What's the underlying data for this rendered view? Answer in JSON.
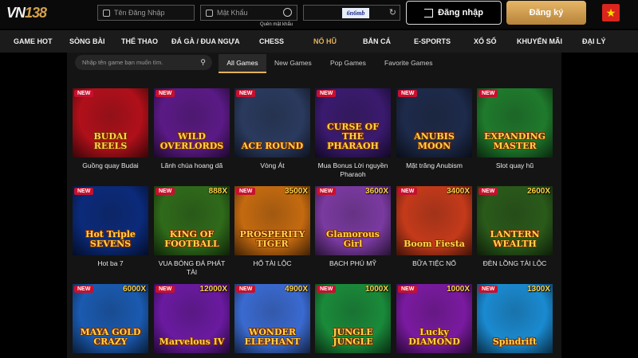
{
  "header": {
    "logo_main": "VN",
    "logo_num": "138",
    "username_placeholder": "Tên Đăng Nhập",
    "password_placeholder": "Mật Khẩu",
    "forgot_password": "Quên mật khẩu",
    "captcha_text": "6n6mb",
    "refresh_icon": "↻",
    "login_label": "Đăng nhập",
    "register_label": "Đăng ký",
    "flag_star": "★"
  },
  "nav": {
    "items": [
      "GAME HOT",
      "SÒNG BÀI",
      "THỂ THAO",
      "ĐÁ GÀ / ĐUA NGỰA",
      "CHESS",
      "NỔ HŨ",
      "BẮN CÁ",
      "E-SPORTS",
      "XỔ SỐ",
      "KHUYẾN MÃI",
      "ĐẠI LÝ"
    ],
    "active": "NỔ HŨ"
  },
  "search": {
    "placeholder": "Nhập tên game bạn muốn tìm."
  },
  "tabs": [
    "All Games",
    "New Games",
    "Pop Games",
    "Favorite Games"
  ],
  "badge_text": "NEW",
  "games": [
    {
      "caption": "Guồng quay Budai",
      "title": "BUDAI REELS",
      "multiplier": "",
      "bg": "#b0101a"
    },
    {
      "caption": "Lãnh chúa hoang dã",
      "title": "WILD OVERLORDS",
      "multiplier": "",
      "bg": "#5b1a86"
    },
    {
      "caption": "Vòng Át",
      "title": "ACE ROUND",
      "multiplier": "",
      "bg": "#2a3a5e"
    },
    {
      "caption": "Mua Bonus Lời nguyền Pharaoh",
      "title": "CURSE OF THE PHARAOH",
      "multiplier": "",
      "bg": "#3a1a6e"
    },
    {
      "caption": "Mặt trăng Anubism",
      "title": "ANUBIS MOON",
      "multiplier": "",
      "bg": "#1d2a4a"
    },
    {
      "caption": "Slot quay hũ",
      "title": "EXPANDING MASTER",
      "multiplier": "",
      "bg": "#1f7a2c"
    },
    {
      "caption": "Hot ba 7",
      "title": "Hot Triple SEVENS",
      "multiplier": "",
      "bg": "#0b2a7a"
    },
    {
      "caption": "VUA BÓNG ĐÁ PHÁT TÀI",
      "title": "KING OF FOOTBALL",
      "multiplier": "888X",
      "bg": "#2f6a1a"
    },
    {
      "caption": "HỔ TÀI LỘC",
      "title": "PROSPERITY TIGER",
      "multiplier": "3500X",
      "bg": "#c46a10"
    },
    {
      "caption": "BẠCH PHÚ MỸ",
      "title": "Glamorous Girl",
      "multiplier": "3600X",
      "bg": "#7a3aa0"
    },
    {
      "caption": "BỮA TIỆC NỔ",
      "title": "Boom Fiesta",
      "multiplier": "3400X",
      "bg": "#c43a1a"
    },
    {
      "caption": "ĐÈN LỒNG TÀI LỘC",
      "title": "LANTERN WEALTH",
      "multiplier": "2600X",
      "bg": "#2a5a1a"
    },
    {
      "caption": "",
      "title": "MAYA GOLD CRAZY",
      "multiplier": "6000X",
      "bg": "#1a5ab0"
    },
    {
      "caption": "",
      "title": "Marvelous IV",
      "multiplier": "12000X",
      "bg": "#6a1aa0"
    },
    {
      "caption": "",
      "title": "WONDER ELEPHANT",
      "multiplier": "4900X",
      "bg": "#3a6ad0"
    },
    {
      "caption": "",
      "title": "JUNGLE JUNGLE",
      "multiplier": "1000X",
      "bg": "#1a8a3a"
    },
    {
      "caption": "",
      "title": "Lucky DIAMOND",
      "multiplier": "1000X",
      "bg": "#7a1aa0"
    },
    {
      "caption": "",
      "title": "Spindrift",
      "multiplier": "1300X",
      "bg": "#1a8ad0"
    }
  ]
}
